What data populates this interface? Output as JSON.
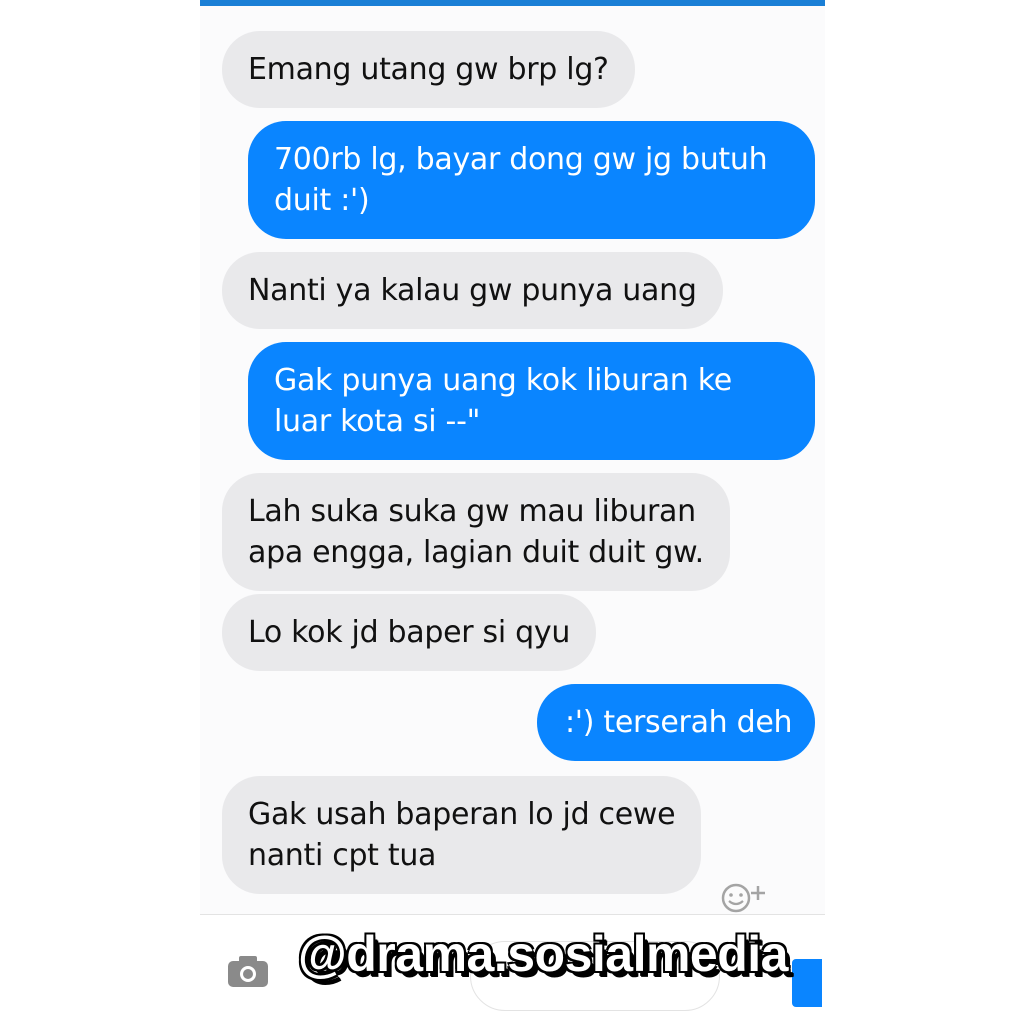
{
  "colors": {
    "accent": "#1a7fd6",
    "outgoing_bubble": "#0a85ff",
    "incoming_bubble": "#e9e9eb"
  },
  "messages": [
    {
      "direction": "incoming",
      "lines": [
        "Emang utang gw brp lg?"
      ]
    },
    {
      "direction": "outgoing",
      "lines": [
        "700rb lg, bayar dong gw jg butuh",
        "duit :')"
      ]
    },
    {
      "direction": "incoming",
      "lines": [
        "Nanti ya kalau gw punya uang"
      ]
    },
    {
      "direction": "outgoing",
      "lines": [
        "Gak punya uang kok liburan ke",
        "luar kota si --\""
      ]
    },
    {
      "direction": "incoming",
      "lines": [
        "Lah suka suka gw mau liburan",
        "apa engga, lagian duit duit gw."
      ]
    },
    {
      "direction": "incoming",
      "lines": [
        "Lo kok jd baper si qyu"
      ]
    },
    {
      "direction": "outgoing",
      "lines": [
        ":') terserah deh"
      ]
    },
    {
      "direction": "incoming",
      "lines": [
        "Gak usah baperan lo jd cewe",
        "nanti cpt tua"
      ]
    }
  ],
  "composer": {
    "camera_icon": "camera-icon",
    "emoji_icon": "emoji-plus-icon",
    "like_icon": "thumbs-up-icon"
  },
  "watermark": {
    "text": "@drama.sosialmedia"
  }
}
